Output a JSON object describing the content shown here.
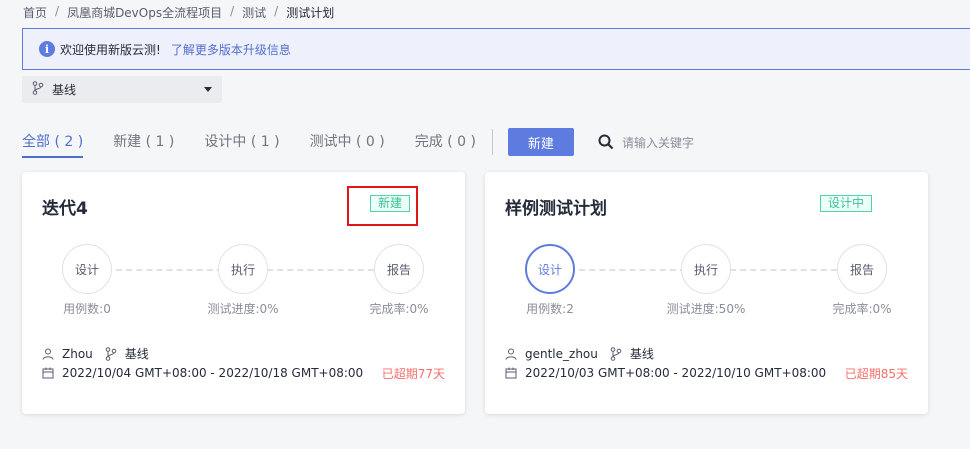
{
  "breadcrumb": [
    "首页",
    "凤凰商城DevOps全流程项目",
    "测试",
    "测试计划"
  ],
  "notice": {
    "text": "欢迎使用新版云测!",
    "link": "了解更多版本升级信息"
  },
  "branch": {
    "selected": "基线"
  },
  "tabs": [
    "全部 ( 2 )",
    "新建 ( 1 )",
    "设计中 ( 1 )",
    "测试中 ( 0 )",
    "完成 ( 0 )"
  ],
  "new_button": "新建",
  "search": {
    "placeholder": "请输入关键字"
  },
  "cards": [
    {
      "title": "迭代4",
      "status": "新建",
      "steps": [
        "设计",
        "执行",
        "报告"
      ],
      "stats": [
        "用例数:0",
        "测试进度:0%",
        "完成率:0%"
      ],
      "owner": "Zhou",
      "branch": "基线",
      "date_range": "2022/10/04 GMT+08:00 - 2022/10/18 GMT+08:00",
      "overdue": "已超期77天"
    },
    {
      "title": "样例测试计划",
      "status": "设计中",
      "steps": [
        "设计",
        "执行",
        "报告"
      ],
      "stats": [
        "用例数:2",
        "测试进度:50%",
        "完成率:0%"
      ],
      "owner": "gentle_zhou",
      "branch": "基线",
      "date_range": "2022/10/03 GMT+08:00 - 2022/10/10 GMT+08:00",
      "overdue": "已超期85天"
    }
  ],
  "colors": {
    "accent": "#5e7ce0",
    "status_green": "#3ac295",
    "overdue_red": "#f66f6a",
    "highlight_red": "#e0171a"
  }
}
